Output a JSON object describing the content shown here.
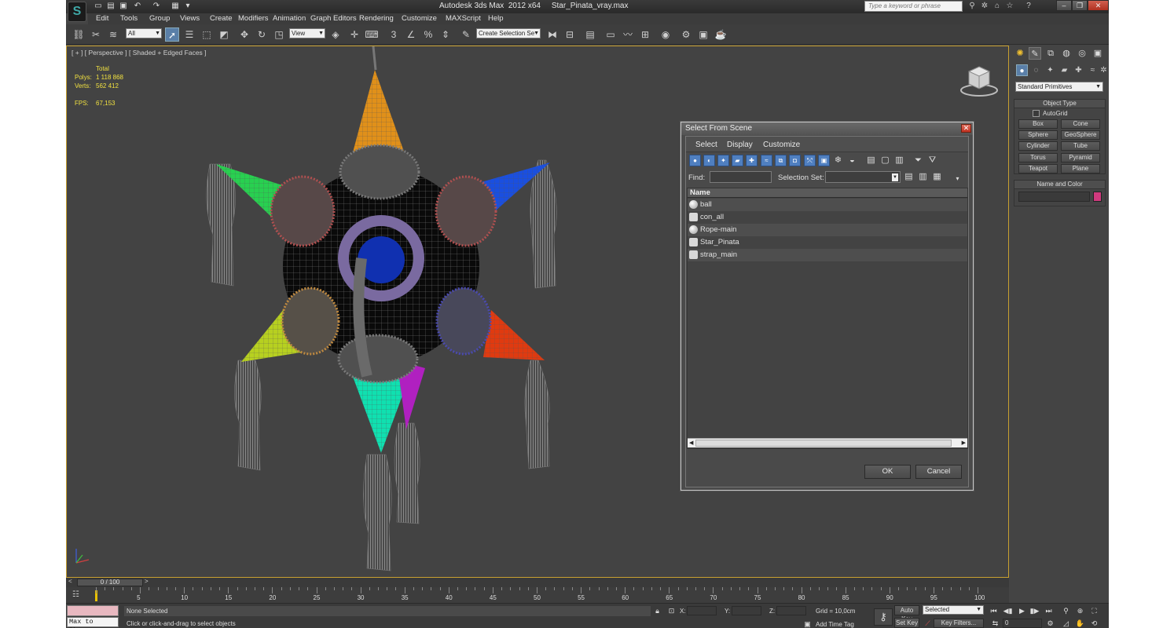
{
  "window": {
    "title": "Autodesk 3ds Max  2012 x64     Star_Pinata_vray.max",
    "search_placeholder": "Type a keyword or phrase"
  },
  "menu": [
    "Edit",
    "Tools",
    "Group",
    "Views",
    "Create",
    "Modifiers",
    "Animation",
    "Graph Editors",
    "Rendering",
    "Customize",
    "MAXScript",
    "Help"
  ],
  "toolbar": {
    "selection_filter": "All",
    "ref_coord": "View",
    "named_selection": "Create Selection Se"
  },
  "viewport": {
    "label": "[ + ] [ Perspective ] [ Shaded + Edged Faces ]",
    "stats": {
      "total_label": "Total",
      "polys_label": "Polys:",
      "polys": "1 118 868",
      "verts_label": "Verts:",
      "verts": "562 412",
      "fps_label": "FPS:",
      "fps": "67,153"
    }
  },
  "command_panel": {
    "category": "Standard Primitives",
    "object_type_title": "Object Type",
    "autogrid": "AutoGrid",
    "buttons": [
      "Box",
      "Cone",
      "Sphere",
      "GeoSphere",
      "Cylinder",
      "Tube",
      "Torus",
      "Pyramid",
      "Teapot",
      "Plane"
    ],
    "name_color_title": "Name and Color",
    "swatch_color": "#d13a7e"
  },
  "dialog": {
    "title": "Select From Scene",
    "menus": [
      "Select",
      "Display",
      "Customize"
    ],
    "find_label": "Find:",
    "selection_set_label": "Selection Set:",
    "column_name": "Name",
    "rows": [
      {
        "name": "ball",
        "icon": "geometry-sphere-icon"
      },
      {
        "name": "con_all",
        "icon": "shape-icon"
      },
      {
        "name": "Rope-main",
        "icon": "geometry-sphere-icon"
      },
      {
        "name": "Star_Pinata",
        "icon": "shape-icon"
      },
      {
        "name": "strap_main",
        "icon": "shape-icon"
      }
    ],
    "ok": "OK",
    "cancel": "Cancel"
  },
  "timeline": {
    "frame_range": "0 / 100",
    "ticks": [
      "5",
      "10",
      "15",
      "20",
      "25",
      "30",
      "35",
      "40",
      "45",
      "50",
      "55",
      "60",
      "65",
      "70",
      "75",
      "80",
      "85",
      "90",
      "95",
      "100"
    ]
  },
  "status": {
    "listener": "Max to Physc.",
    "selection": "None Selected",
    "prompt": "Click or click-and-drag to select objects",
    "x_label": "X:",
    "y_label": "Y:",
    "z_label": "Z:",
    "grid": "Grid = 10,0cm",
    "add_time_tag": "Add Time Tag",
    "auto_key": "Auto Key",
    "set_key": "Set Key",
    "key_mode": "Selected",
    "key_filters": "Key Filters...",
    "current_frame": "0"
  }
}
